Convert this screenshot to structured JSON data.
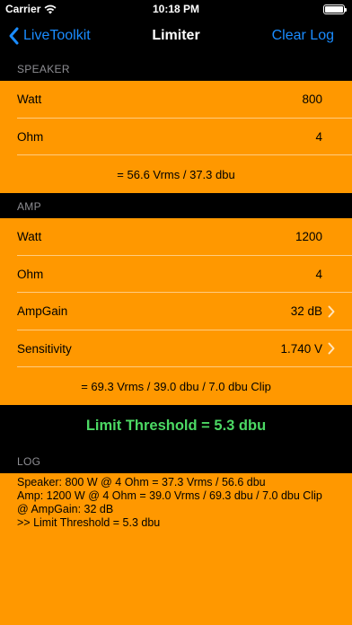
{
  "status_bar": {
    "carrier": "Carrier",
    "time": "10:18 PM"
  },
  "nav": {
    "back_label": "LiveToolkit",
    "title": "Limiter",
    "clear_label": "Clear Log"
  },
  "speaker": {
    "header": "SPEAKER",
    "watt_label": "Watt",
    "watt_value": "800",
    "ohm_label": "Ohm",
    "ohm_value": "4",
    "result": "= 56.6 Vrms / 37.3 dbu"
  },
  "amp": {
    "header": "AMP",
    "watt_label": "Watt",
    "watt_value": "1200",
    "ohm_label": "Ohm",
    "ohm_value": "4",
    "gain_label": "AmpGain",
    "gain_value": "32 dB",
    "sensitivity_label": "Sensitivity",
    "sensitivity_value": "1.740 V",
    "result": "= 69.3 Vrms / 39.0 dbu / 7.0 dbu Clip"
  },
  "threshold": "Limit Threshold = 5.3 dbu",
  "log": {
    "header": "LOG",
    "text": "Speaker: 800 W @ 4 Ohm = 37.3 Vrms / 56.6 dbu\nAmp: 1200 W @ 4 Ohm = 39.0 Vrms / 69.3 dbu / 7.0 dbu Clip\n@ AmpGain: 32 dB\n>> Limit Threshold = 5.3 dbu"
  },
  "colors": {
    "accent": "#ff9800",
    "link": "#1a8cff",
    "threshold": "#4cd964"
  }
}
